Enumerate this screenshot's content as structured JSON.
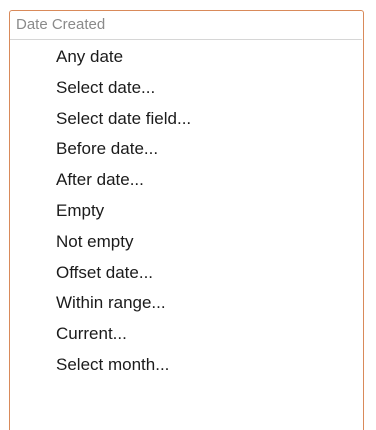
{
  "menu": {
    "header": "Date Created",
    "items": [
      {
        "label": "Any date"
      },
      {
        "label": "Select date..."
      },
      {
        "label": "Select date field..."
      },
      {
        "label": "Before date..."
      },
      {
        "label": "After date..."
      },
      {
        "label": "Empty"
      },
      {
        "label": "Not empty"
      },
      {
        "label": "Offset date..."
      },
      {
        "label": "Within range..."
      },
      {
        "label": "Current..."
      },
      {
        "label": "Select month..."
      }
    ]
  }
}
